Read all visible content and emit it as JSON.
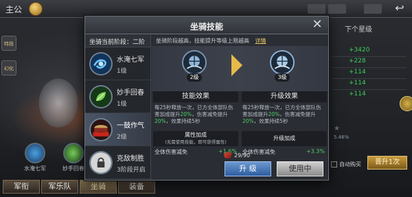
{
  "topbar": {
    "title": "主公",
    "back_label": "↩"
  },
  "side_tags": [
    "特技",
    "幻化"
  ],
  "background_skills": [
    {
      "name": "水淹七军"
    },
    {
      "name": "妙手回春"
    }
  ],
  "bottom_tabs": [
    {
      "label": "军衔",
      "active": false
    },
    {
      "label": "军乐队",
      "active": false
    },
    {
      "label": "坐骑",
      "active": true
    },
    {
      "label": "装备",
      "active": false
    }
  ],
  "right_panel": {
    "header": "下个星级",
    "values": [
      "+3420",
      "+228",
      "+114",
      "+114",
      "+114"
    ],
    "auto_label": "自动购买",
    "button_label": "晋升1次",
    "small_text": "5.46%"
  },
  "modal": {
    "title": "坐骑技能",
    "close_icon": "close-icon",
    "list_header": "坐骑当前阶段：二阶",
    "skills": [
      {
        "name": "水淹七军",
        "level": "1级",
        "icon": "water-swirl-icon",
        "selected": false
      },
      {
        "name": "妙手回春",
        "level": "1级",
        "icon": "leaf-heal-icon",
        "selected": false
      },
      {
        "name": "一鼓作气",
        "level": "2级",
        "icon": "war-drum-icon",
        "selected": true
      },
      {
        "name": "克敌制胜",
        "level": "3阶段开启",
        "icon": "locked-shield-icon",
        "selected": false
      }
    ],
    "info_text": "坐骑阶段越高，技能提升等级上限越高",
    "info_link": "详情",
    "current_level_badge": "2级",
    "next_level_badge": "3级",
    "col_skill_effect": "技能效果",
    "col_upgrade_effect": "升级效果",
    "effect_current": {
      "pre": "每25秒释放一次，已方全体部队伤害加成提升",
      "v1": "20%",
      "mid": "，伤害减免提升",
      "v2": "20%",
      "post": "，效果持续5秒"
    },
    "effect_next": {
      "pre": "每25秒释放一次，已方全体部队伤害加成提升",
      "v1": "20%",
      "mid": "，伤害减免提升",
      "v2": "20%",
      "post": "，效果持续5秒"
    },
    "attr_head_current": "属性加成",
    "attr_head_current_sub": "(无需使用技能，即可获得属性)",
    "attr_head_next": "升级加成",
    "attr_current_label": "全体伤害减免",
    "attr_current_value": "+1.6%",
    "attr_next_label": "全体伤害减免",
    "attr_next_value": "+3.3%",
    "cost": "29/90",
    "upgrade_button": "升  级",
    "using_button": "使用中"
  }
}
